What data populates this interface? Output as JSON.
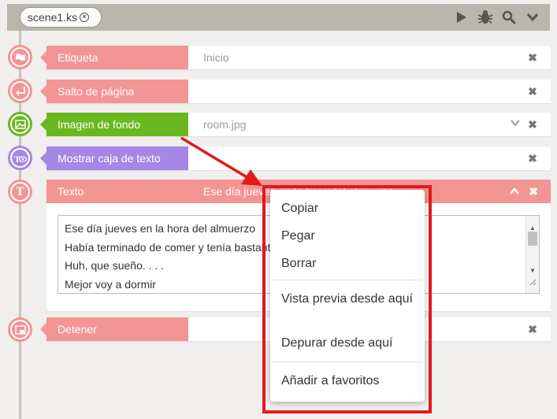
{
  "tab": {
    "label": "scene1.ks"
  },
  "toolbar_icons": [
    "play-icon",
    "bug-icon",
    "search-icon",
    "chevron-down-icon"
  ],
  "rows": {
    "etiqueta": {
      "label": "Etiqueta",
      "value": "Inicio",
      "color": "#f39594"
    },
    "salto": {
      "label": "Salto de página",
      "value": "",
      "color": "#f39594"
    },
    "imagen": {
      "label": "Imagen de fondo",
      "value": "room.jpg",
      "color": "#6ab71f"
    },
    "mostrar": {
      "label": "Mostrar caja de texto",
      "value": "",
      "color": "#a487e6"
    },
    "texto": {
      "label": "Texto",
      "preview": "Ese día jueves en la hora del almuerzo",
      "lines": [
        "Ese día jueves en la hora del almuerzo",
        "Había terminado de comer y tenía bastante sueño",
        "Huh, que sueño. . . .",
        "Mejor voy a dormir"
      ]
    },
    "detener": {
      "label": "Detener",
      "value": "",
      "color": "#f39594"
    }
  },
  "context_menu": {
    "copy": "Copiar",
    "paste": "Pegar",
    "delete": "Borrar",
    "preview_from_here": "Vista previa desde aquí",
    "debug_from_here": "Depurar desde aquí",
    "add_favorites": "Añadir a favoritos"
  },
  "highlight_color": "#e11b1b"
}
